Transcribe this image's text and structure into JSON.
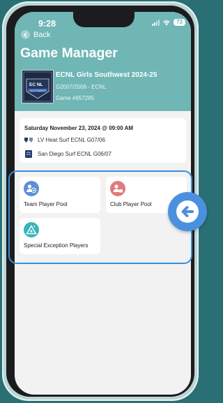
{
  "status_bar": {
    "time": "9:28",
    "battery": "73"
  },
  "header": {
    "back_label": "Back",
    "title": "Game Manager",
    "event_title": "ECNL Girls Southwest 2024-25",
    "event_subtitle": "G2007/2006 - ECNL",
    "event_game": "Game #657285",
    "logo_text_top": "EC  NL",
    "logo_text_bottom": "SOUTHWEST"
  },
  "match": {
    "date_time": "Saturday November 23, 2024 @ 09:00 AM",
    "home_team": "LV Heat Surf ECNL G07/06",
    "away_team": "San Diego Surf ECNL G06/07"
  },
  "tiles": {
    "team_player_pool": "Team Player Pool",
    "club_player_pool": "Club Player Pool",
    "special_exception_players": "Special Exception Players"
  },
  "colors": {
    "header": "#6fb6b5",
    "team_pool_icon": "#5b8fd6",
    "club_pool_icon": "#e07b7b",
    "special_icon": "#37b5b8",
    "highlight": "#3a8fd8"
  }
}
